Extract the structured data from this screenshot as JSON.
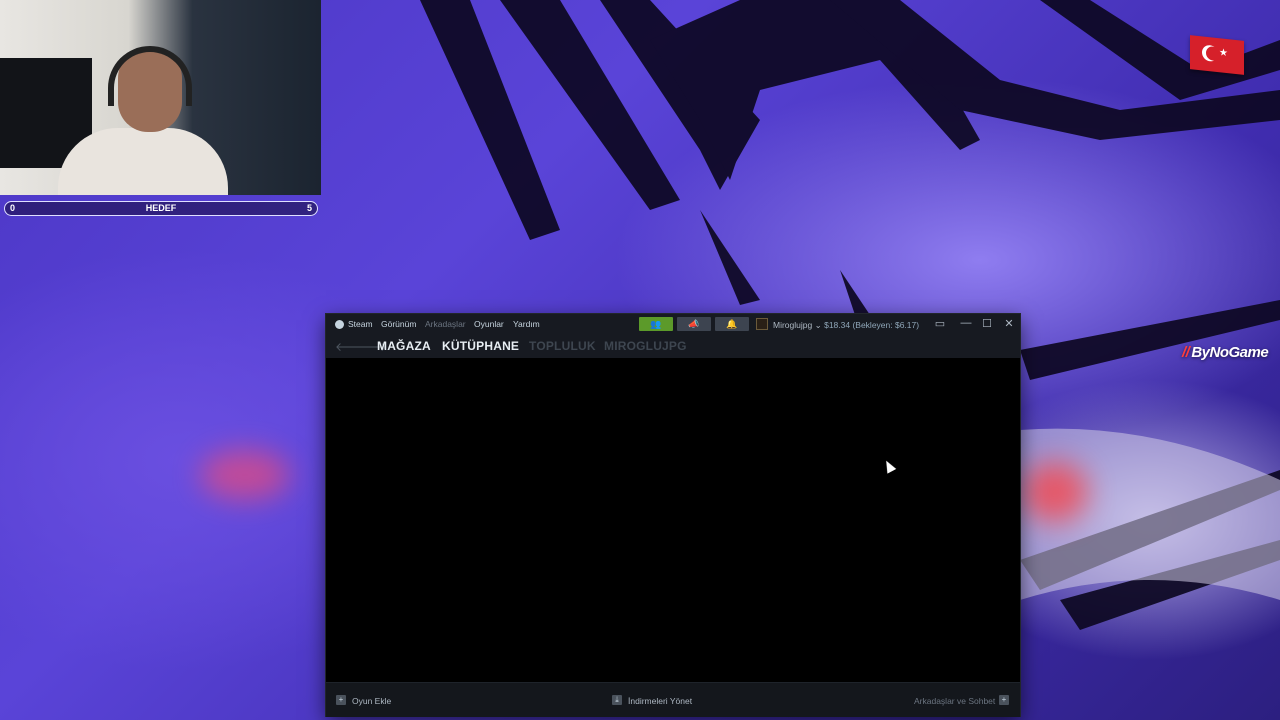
{
  "stream_overlay": {
    "goal": {
      "label": "HEDEF",
      "current": "0",
      "target": "5"
    },
    "brand": "ByNoGame",
    "brand_mark": "//"
  },
  "steam": {
    "menu": [
      "Steam",
      "Görünüm",
      "Arkadaşlar",
      "Oyunlar",
      "Yardım"
    ],
    "account_name": "Miroglujpg",
    "wallet": "$18.34 (Bekleyen: $6.17)",
    "nav_tabs": [
      "MAĞAZA",
      "KÜTÜPHANE",
      "TOPLULUK",
      "MIROGLUJPG"
    ],
    "footer": {
      "add_game": "Oyun Ekle",
      "downloads": "İndirmeleri Yönet",
      "friends_chat": "Arkadaşlar ve Sohbet"
    },
    "icons": {
      "friends": "👥",
      "announcements": "📣",
      "notifications": "🔔",
      "back": "🡐",
      "forward": "🡒",
      "minimize": "—",
      "maximize": "☐",
      "close": "✕",
      "big_picture": "▭"
    }
  },
  "colors": {
    "steam_green": "#5c9a2a",
    "wallpaper": "#4b36c4",
    "flag_red": "#d6202a"
  }
}
